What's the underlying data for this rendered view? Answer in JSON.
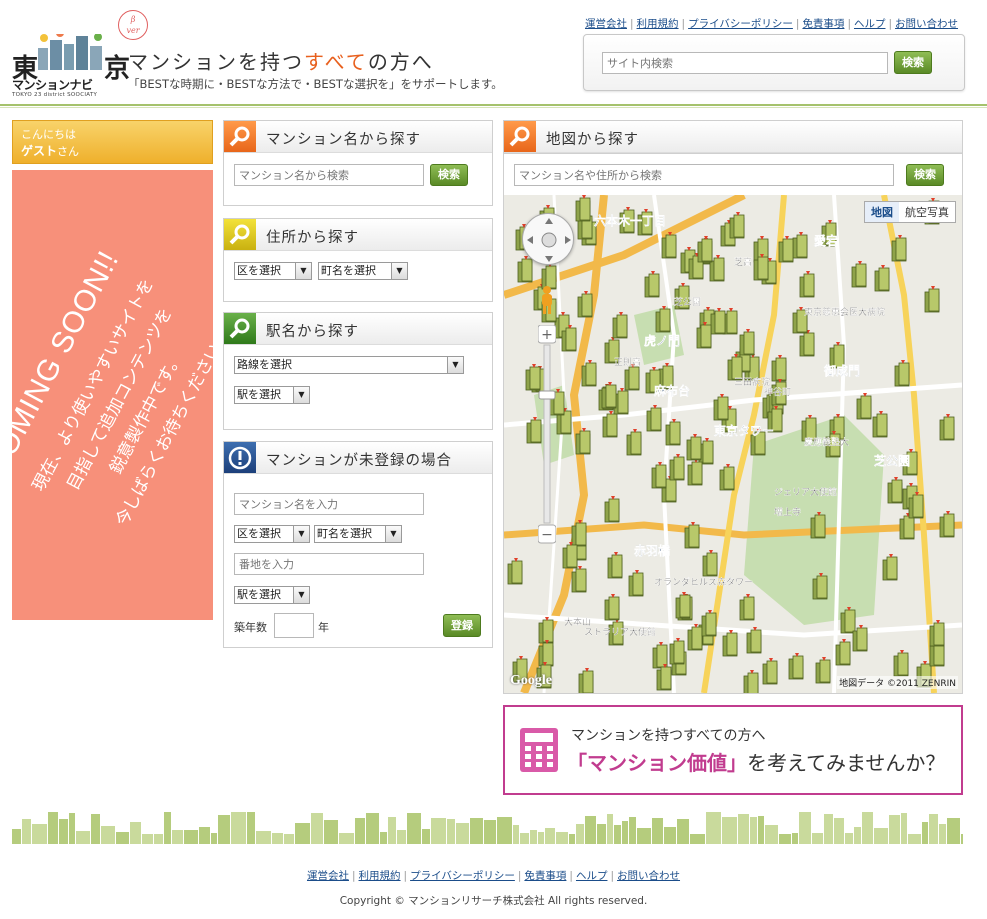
{
  "header": {
    "logo": {
      "line1_left": "東",
      "line1_right": "京",
      "line2": "マンションナビ",
      "line3": "TOKYO 23 district SOOCIATY",
      "beta": "β",
      "beta_ver": "ver"
    },
    "tagline_pre": "マンションを持つ",
    "tagline_accent": "すべて",
    "tagline_post": "の方へ",
    "subtagline": "「BESTな時期に・BESTな方法で・BESTな選択を」をサポートします。",
    "links": [
      "運営会社",
      "利用規約",
      "プライバシーポリシー",
      "免責事項",
      "ヘルプ",
      "お問い合わせ"
    ],
    "search": {
      "placeholder": "サイト内検索",
      "button": "検索"
    },
    "accent_color": "#e8601e",
    "line_color": "#a5c26c"
  },
  "guest": {
    "greeting": "こんにちは",
    "name": "ゲスト",
    "suffix": "さん",
    "coming_soon": "COMING SOON!!",
    "message_lines": [
      "現在、より使いやすいサイトを",
      "目指して追加コンテンツを",
      "鋭意製作中です。",
      "今しばらくお待ちください。"
    ],
    "bg_color": "#f7907a"
  },
  "panels": {
    "by_name": {
      "title": "マンション名から探す",
      "placeholder": "マンション名から検索",
      "button": "検索",
      "icon": "magnifier-icon"
    },
    "by_address": {
      "title": "住所から探す",
      "ward": "区を選択",
      "town": "町名を選択",
      "icon": "magnifier-icon"
    },
    "by_station": {
      "title": "駅名から探す",
      "line": "路線を選択",
      "station": "駅を選択",
      "icon": "magnifier-icon"
    },
    "unregistered": {
      "title": "マンションが未登録の場合",
      "name_placeholder": "マンション名を入力",
      "ward": "区を選択",
      "town": "町名を選択",
      "lot_placeholder": "番地を入力",
      "station": "駅を選択",
      "age_label": "築年数",
      "age_unit": "年",
      "button": "登録",
      "icon": "info-icon"
    }
  },
  "map_panel": {
    "title": "地図から探す",
    "placeholder": "マンション名や住所から検索",
    "button": "検索",
    "type_map": "地図",
    "type_satellite": "航空写真",
    "copyright": "地図データ ©2011 ZENRIN",
    "google": "Google",
    "labels": [
      "六本木一丁目",
      "虎ノ門",
      "麻布台",
      "御成門",
      "芝公園",
      "赤羽橋",
      "愛宕",
      "東京タワー",
      "増上寺",
      "慶應義塾大",
      "東京慈恵会医大病院",
      "芝公園",
      "三田病院",
      "神谷町",
      "芝高",
      "正則高",
      "ジェリア大使館",
      "オランダヒルズ森タワー",
      "大本山",
      "ストラリア大使館"
    ]
  },
  "banner": {
    "line1": "マンションを持つすべての方へ",
    "highlight": "「マンション価値」",
    "line2_post": "を考えてみませんか？",
    "color": "#c13c8f"
  },
  "footer": {
    "links": [
      "運営会社",
      "利用規約",
      "プライバシーポリシー",
      "免責事項",
      "ヘルプ",
      "お問い合わせ"
    ],
    "copyright": "Copyright ©  マンションリサーチ株式会社 All rights reserved."
  }
}
